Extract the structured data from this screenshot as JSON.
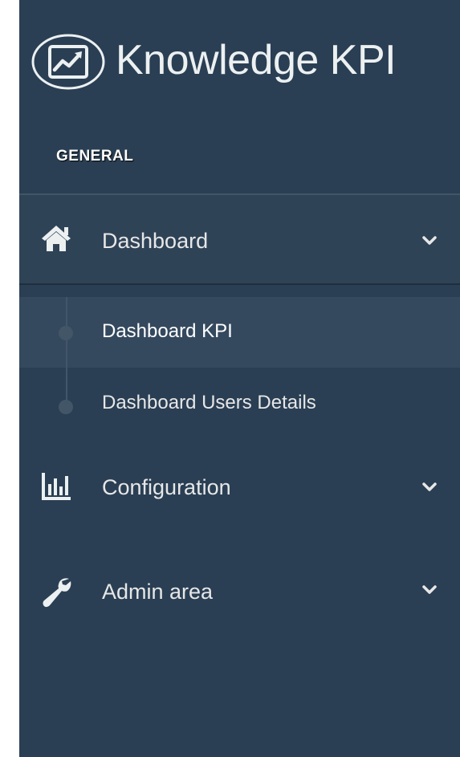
{
  "brand": {
    "icon": "line-chart-icon",
    "title": "Knowledge KPI"
  },
  "section": {
    "title": "GENERAL"
  },
  "menu": [
    {
      "icon": "home-icon",
      "label": "Dashboard",
      "expanded": true,
      "children": [
        {
          "label": "Dashboard KPI",
          "current": true
        },
        {
          "label": "Dashboard Users Details",
          "current": false
        }
      ]
    },
    {
      "icon": "bar-chart-icon",
      "label": "Configuration",
      "expanded": false
    },
    {
      "icon": "wrench-icon",
      "label": "Admin area",
      "expanded": false
    }
  ],
  "colors": {
    "sidebar_bg": "#2a3f54",
    "active_item_bg": "#2f4357",
    "current_child_bg": "#34495e",
    "text": "#e7e7e7",
    "divider": "#425668"
  }
}
